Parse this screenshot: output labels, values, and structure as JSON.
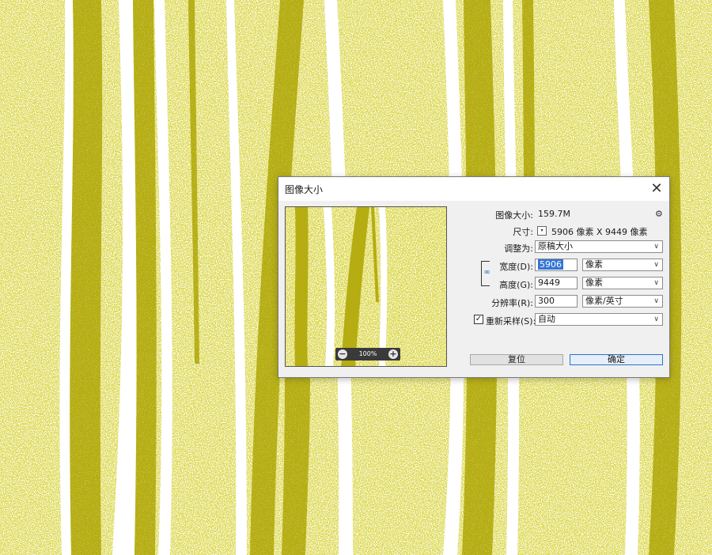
{
  "dialog": {
    "title": "图像大小",
    "close_glyph": "✕",
    "image_size_label": "图像大小:",
    "image_size_value": "159.7M",
    "dimensions_label": "尺寸:",
    "dimensions_value": "5906 像素  X  9449 像素",
    "fit_to_label": "调整为:",
    "fit_to_value": "原稿大小",
    "width_label": "宽度(D):",
    "width_value": "5906",
    "width_unit": "像素",
    "height_label": "高度(G):",
    "height_value": "9449",
    "height_unit": "像素",
    "resolution_label": "分辨率(R):",
    "resolution_value": "300",
    "resolution_unit": "像素/英寸",
    "resample_label": "重新采样(S):",
    "resample_checked": true,
    "resample_value": "自动",
    "reset_label": "复位",
    "ok_label": "确定",
    "zoom_level": "100%",
    "zoom_out_glyph": "−",
    "zoom_in_glyph": "+",
    "chevron_glyph": "∨",
    "link_glyph": "∞",
    "gear_glyph": "⚙",
    "dropdown_glyph": "▾",
    "checkbox_glyph": "✓"
  },
  "colors": {
    "stripe": "#b5ad12",
    "background": "#ffffff",
    "accent": "#2b73c4"
  },
  "icons": [
    "close-icon",
    "gear-icon",
    "link-icon",
    "zoom-out-icon",
    "zoom-in-icon",
    "chevron-down-icon",
    "checkbox-icon"
  ]
}
